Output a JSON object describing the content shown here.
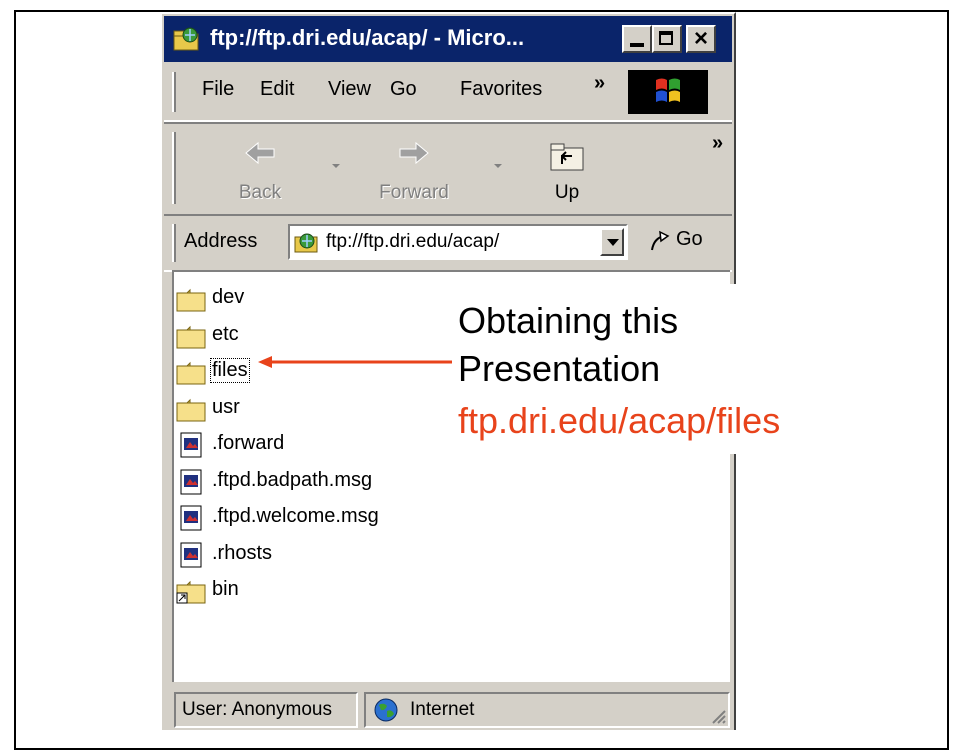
{
  "window": {
    "title": "ftp://ftp.dri.edu/acap/ - Micro...",
    "close_glyph": "×"
  },
  "menu": {
    "items": [
      "File",
      "Edit",
      "View",
      "Go",
      "Favorites"
    ],
    "overflow": "»"
  },
  "toolbar": {
    "back_label": "Back",
    "forward_label": "Forward",
    "up_label": "Up",
    "overflow": "»"
  },
  "address": {
    "label": "Address",
    "value": "ftp://ftp.dri.edu/acap/",
    "go_label": "Go"
  },
  "files": [
    {
      "name": "dev",
      "type": "folder"
    },
    {
      "name": "etc",
      "type": "folder"
    },
    {
      "name": "files",
      "type": "folder",
      "selected": true
    },
    {
      "name": "usr",
      "type": "folder"
    },
    {
      "name": ".forward",
      "type": "file"
    },
    {
      "name": ".ftpd.badpath.msg",
      "type": "file"
    },
    {
      "name": ".ftpd.welcome.msg",
      "type": "file"
    },
    {
      "name": ".rhosts",
      "type": "file"
    },
    {
      "name": "bin",
      "type": "shortcut-folder"
    }
  ],
  "status": {
    "user": "User: Anonymous",
    "zone": "Internet"
  },
  "callout": {
    "line1": "Obtaining this",
    "line2": "Presentation",
    "link": "ftp.dri.edu/acap/files"
  },
  "colors": {
    "titlebar": "#0a246a",
    "chrome": "#d4d0c8",
    "callout_accent": "#e8431b"
  }
}
